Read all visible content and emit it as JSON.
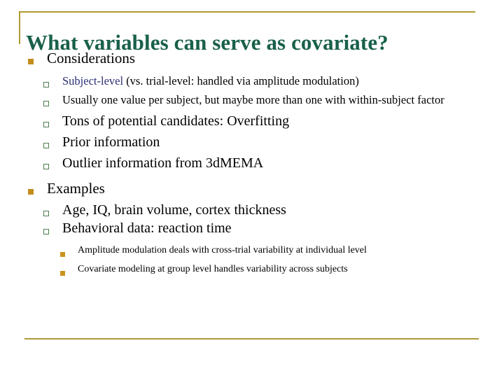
{
  "slide": {
    "title": "What variables can serve as covariate?",
    "title_color": "#19604a",
    "accent_color": "#b09a35",
    "bullet_l1_color": "#c28d1c",
    "bullet_l2_color": "#4f7d4f",
    "bullet_l3_color": "#c89420",
    "highlight_color": "#2c2f77"
  },
  "sections": [
    {
      "heading": "Considerations",
      "items": [
        {
          "lead": "Subject-level",
          "rest": " (vs. trial-level: handled via amplitude modulation)",
          "size": "small"
        },
        {
          "lead": "",
          "rest": "Usually one value per subject, but maybe more than one with within-subject factor",
          "size": "small"
        },
        {
          "lead": "",
          "rest": "Tons of potential candidates: Overfitting",
          "size": "big"
        },
        {
          "lead": "",
          "rest": "Prior information",
          "size": "big"
        },
        {
          "lead": "",
          "rest": "Outlier information from 3dMEMA",
          "size": "big"
        }
      ]
    },
    {
      "heading": "Examples",
      "items": [
        {
          "lead": "",
          "rest": "Age, IQ, brain volume, cortex thickness",
          "size": "big"
        },
        {
          "lead": "",
          "rest": "Behavioral data: reaction time",
          "size": "big"
        }
      ],
      "subitems": [
        "Amplitude modulation deals with cross-trial variability at individual level",
        "Covariate modeling at group level handles variability across subjects"
      ]
    }
  ]
}
